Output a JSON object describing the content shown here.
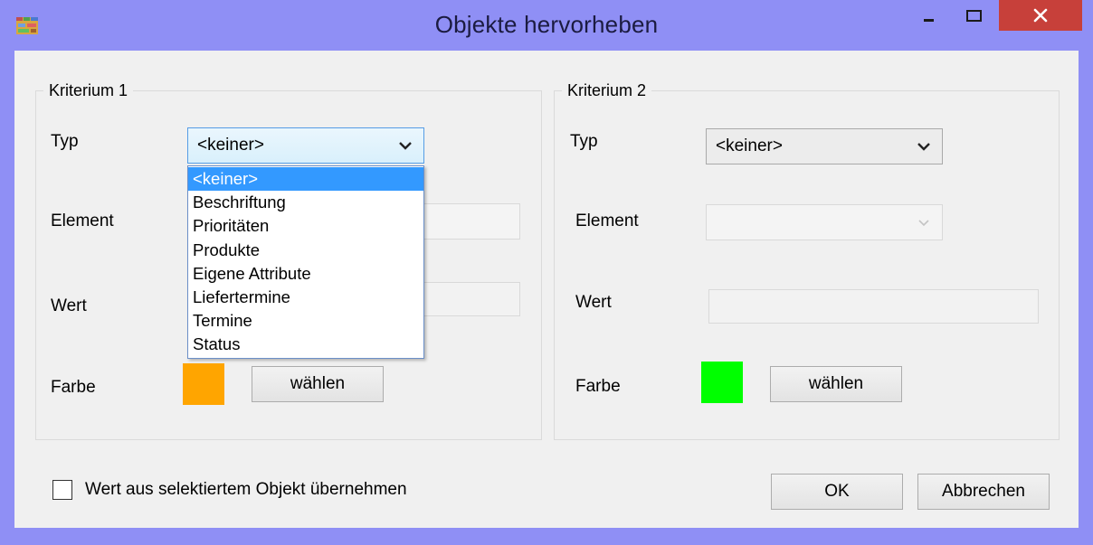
{
  "window": {
    "title": "Objekte hervorheben",
    "controls": {
      "minimize": "minimize",
      "maximize": "maximize",
      "close": "close"
    }
  },
  "criterion1": {
    "label": "Kriterium  1",
    "type_label": "Typ",
    "type_value": "<keiner>",
    "element_label": "Element",
    "value_label": "Wert",
    "color_label": "Farbe",
    "color": "#ffa500",
    "choose_button": "wählen",
    "dropdown_open": true,
    "dropdown_options": [
      "<keiner>",
      "Beschriftung",
      "Prioritäten",
      "Produkte",
      "Eigene Attribute",
      "Liefertermine",
      "Termine",
      "Status"
    ],
    "selected_option": "<keiner>"
  },
  "criterion2": {
    "label": "Kriterium 2",
    "type_label": "Typ",
    "type_value": "<keiner>",
    "element_label": "Element",
    "value_label": "Wert",
    "color_label": "Farbe",
    "color": "#00ff00",
    "choose_button": "wählen"
  },
  "footer": {
    "checkbox_label": "Wert aus selektiertem Objekt übernehmen",
    "checkbox_checked": false,
    "ok_button": "OK",
    "cancel_button": "Abbrechen"
  },
  "colors": {
    "frame": "#8f8ff5",
    "close_button": "#c7403a",
    "selection": "#3399ff"
  }
}
